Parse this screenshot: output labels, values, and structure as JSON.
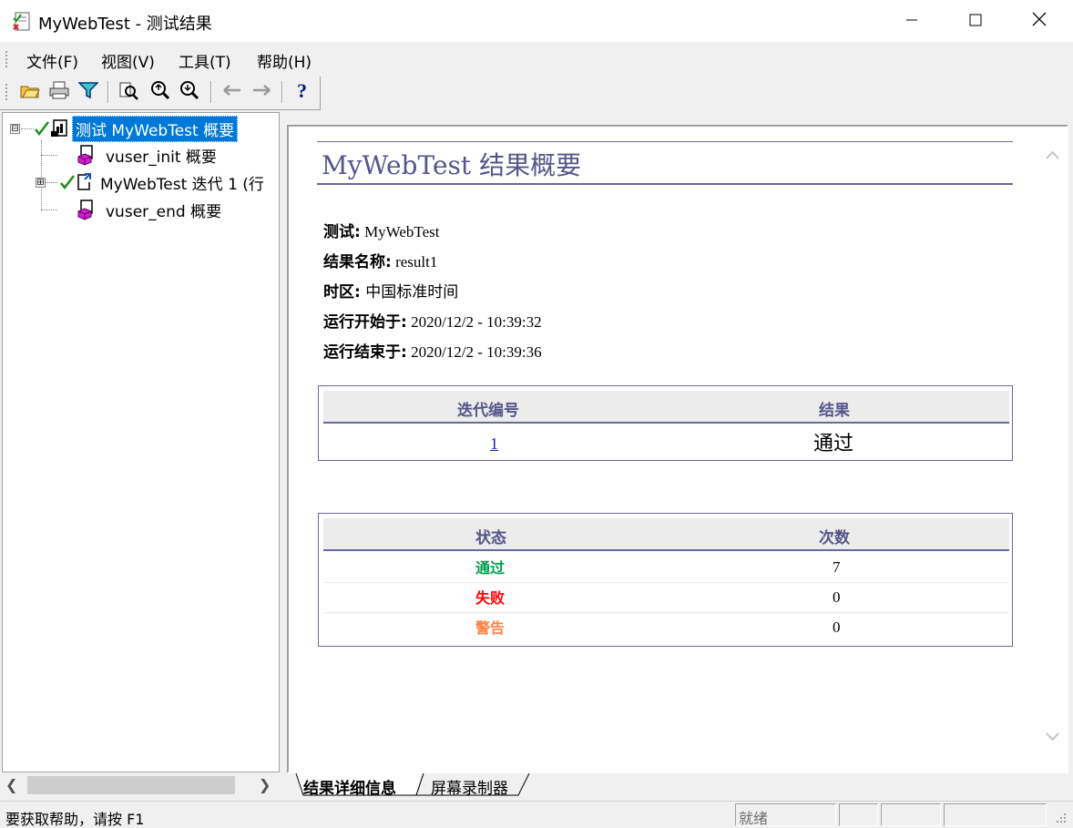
{
  "window": {
    "title": "MyWebTest - 测试结果",
    "icon": "test-results-app-icon"
  },
  "menu": {
    "items": [
      {
        "label": "文件(F)",
        "mnemonic": "F"
      },
      {
        "label": "视图(V)",
        "mnemonic": "V"
      },
      {
        "label": "工具(T)",
        "mnemonic": "T"
      },
      {
        "label": "帮助(H)",
        "mnemonic": "H"
      }
    ]
  },
  "toolbar": {
    "buttons": [
      {
        "icon": "open-folder-icon"
      },
      {
        "icon": "print-icon"
      },
      {
        "icon": "filter-icon"
      },
      {
        "icon": "find-icon"
      },
      {
        "icon": "zoom-in-icon"
      },
      {
        "icon": "zoom-out-icon"
      },
      {
        "icon": "back-arrow-icon"
      },
      {
        "icon": "forward-arrow-icon"
      },
      {
        "icon": "help-icon"
      }
    ]
  },
  "tree": {
    "items": [
      {
        "label": "测试 MyWebTest 概要",
        "status": "passed",
        "expander": "⊟",
        "selected": true
      },
      {
        "label": "vuser_init 概要"
      },
      {
        "label": "MyWebTest 迭代 1 (行",
        "status": "passed",
        "expander": "⊞"
      },
      {
        "label": "vuser_end 概要"
      }
    ]
  },
  "report": {
    "title": "MyWebTest 结果概要",
    "info": [
      {
        "label": "测试:",
        "value": " MyWebTest"
      },
      {
        "label": "结果名称:",
        "value": " result1"
      },
      {
        "label": "时区:",
        "value": " 中国标准时间"
      },
      {
        "label": "运行开始于:",
        "value": " 2020/12/2 - 10:39:32"
      },
      {
        "label": "运行结束于:",
        "value": " 2020/12/2 - 10:39:36"
      }
    ],
    "iteration_table": {
      "headers": [
        "迭代编号",
        "结果"
      ],
      "rows": [
        {
          "iteration": "1",
          "result": "通过"
        }
      ]
    },
    "status_table": {
      "headers": [
        "状态",
        "次数"
      ],
      "rows": [
        {
          "status": "通过",
          "count": "7",
          "color": "#00a050"
        },
        {
          "status": "失败",
          "count": "0",
          "color": "#ff0000"
        },
        {
          "status": "警告",
          "count": "0",
          "color": "#ff8040"
        }
      ]
    }
  },
  "tabs": [
    {
      "label": "结果详细信息",
      "active": true
    },
    {
      "label": "屏幕录制器",
      "active": false
    }
  ],
  "status_bar": {
    "help_text": "要获取帮助，请按 F1",
    "ready_text": "就绪"
  },
  "colors": {
    "accent": "#55558a",
    "selection": "#0078d7",
    "check": "#1a8f1a"
  }
}
